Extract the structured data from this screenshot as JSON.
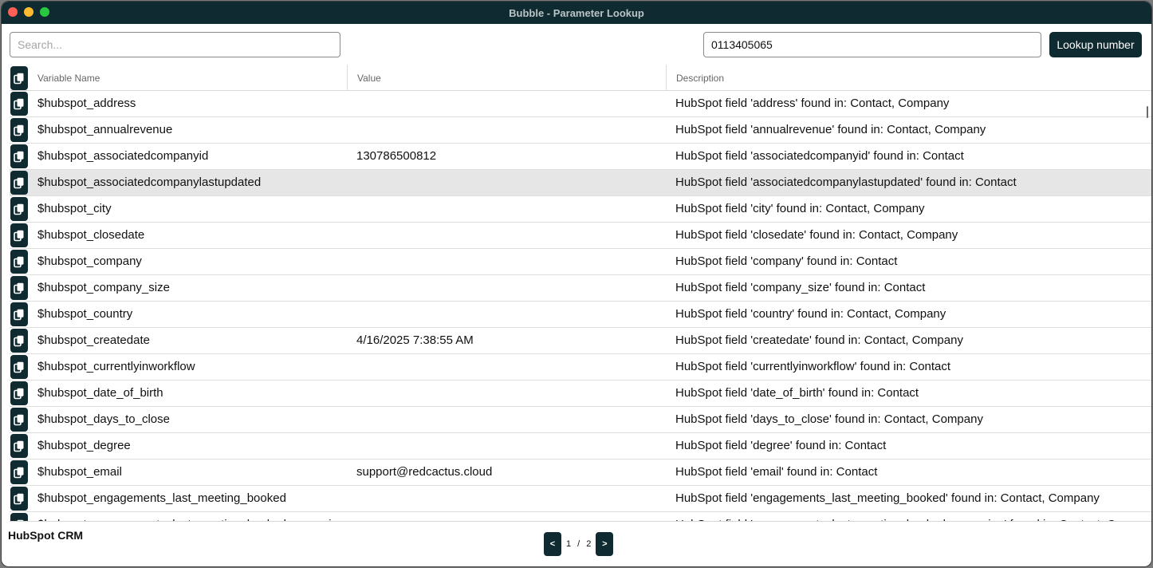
{
  "window": {
    "title": "Bubble - Parameter Lookup"
  },
  "search": {
    "placeholder": "Search..."
  },
  "lookup": {
    "number_value": "0113405065",
    "button_label": "Lookup number"
  },
  "table": {
    "headers": [
      "Variable Name",
      "Value",
      "Description"
    ],
    "rows": [
      {
        "name": "$hubspot_address",
        "value": "",
        "description": "HubSpot field 'address' found in: Contact, Company"
      },
      {
        "name": "$hubspot_annualrevenue",
        "value": "",
        "description": "HubSpot field 'annualrevenue' found in: Contact, Company"
      },
      {
        "name": "$hubspot_associatedcompanyid",
        "value": "130786500812",
        "description": "HubSpot field 'associatedcompanyid' found in: Contact"
      },
      {
        "name": "$hubspot_associatedcompanylastupdated",
        "value": "",
        "description": "HubSpot field 'associatedcompanylastupdated' found in: Contact"
      },
      {
        "name": "$hubspot_city",
        "value": "",
        "description": "HubSpot field 'city' found in: Contact, Company"
      },
      {
        "name": "$hubspot_closedate",
        "value": "",
        "description": "HubSpot field 'closedate' found in: Contact, Company"
      },
      {
        "name": "$hubspot_company",
        "value": "",
        "description": "HubSpot field 'company' found in: Contact"
      },
      {
        "name": "$hubspot_company_size",
        "value": "",
        "description": "HubSpot field 'company_size' found in: Contact"
      },
      {
        "name": "$hubspot_country",
        "value": "",
        "description": "HubSpot field 'country' found in: Contact, Company"
      },
      {
        "name": "$hubspot_createdate",
        "value": "4/16/2025 7:38:55 AM",
        "description": "HubSpot field 'createdate' found in: Contact, Company"
      },
      {
        "name": "$hubspot_currentlyinworkflow",
        "value": "",
        "description": "HubSpot field 'currentlyinworkflow' found in: Contact"
      },
      {
        "name": "$hubspot_date_of_birth",
        "value": "",
        "description": "HubSpot field 'date_of_birth' found in: Contact"
      },
      {
        "name": "$hubspot_days_to_close",
        "value": "",
        "description": "HubSpot field 'days_to_close' found in: Contact, Company"
      },
      {
        "name": "$hubspot_degree",
        "value": "",
        "description": "HubSpot field 'degree' found in: Contact"
      },
      {
        "name": "$hubspot_email",
        "value": "support@redcactus.cloud",
        "description": "HubSpot field 'email' found in: Contact"
      },
      {
        "name": "$hubspot_engagements_last_meeting_booked",
        "value": "",
        "description": "HubSpot field 'engagements_last_meeting_booked' found in: Contact, Company"
      },
      {
        "name": "$hubspot_engagements_last_meeting_booked_campaign",
        "value": "",
        "description": "HubSpot field 'engagements_last_meeting_booked_campaign' found in: Contact, Company"
      }
    ],
    "highlighted_row": 3
  },
  "footer": {
    "label": "HubSpot CRM"
  },
  "pagination": {
    "prev": "<",
    "current": "1",
    "separator": "/",
    "total": "2",
    "next": ">"
  },
  "icons": {
    "copy": "copy-icon"
  },
  "colors": {
    "accent": "#0f2a30"
  }
}
